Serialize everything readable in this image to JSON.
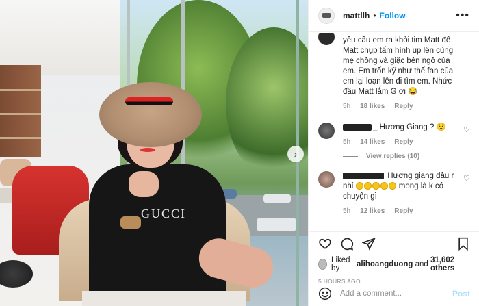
{
  "post": {
    "username": "mattllh",
    "separator": "•",
    "follow_label": "Follow",
    "more_label": "•••"
  },
  "photo": {
    "shirt_text": "GUCCI",
    "next_label": "›"
  },
  "comments": [
    {
      "text": "yêu cầu em ra khỏi tim Matt để Matt chụp tấm hình up lên cùng mẹ chồng và giặc bên ngô của em. Em trốn kỹ như thế fan của em lại loạn lên đi tìm em. Nhức đầu Matt lắm G ơi 😂",
      "time": "5h",
      "likes": "18 likes",
      "reply": "Reply"
    },
    {
      "text": "_ Hương Giang ? 😟",
      "time": "5h",
      "likes": "14 likes",
      "reply": "Reply",
      "view_replies": "View replies (10)"
    },
    {
      "text_a": "Hương giang đâu r nhỉ",
      "text_b": "mong là k có chuyện gì",
      "time": "5h",
      "likes": "12 likes",
      "reply": "Reply"
    }
  ],
  "actions": {
    "liked_prefix": "Liked by",
    "liked_user": "alihoangduong",
    "liked_and": "and",
    "liked_count": "31,602 others",
    "timestamp": "5 HOURS AGO"
  },
  "composer": {
    "placeholder": "Add a comment...",
    "post_label": "Post"
  },
  "icons": {
    "heart": "heart-icon",
    "comment": "comment-icon",
    "share": "share-icon",
    "save": "bookmark-icon",
    "emoji": "emoji-icon"
  },
  "colors": {
    "follow": "#0095f6",
    "post_disabled": "#b2dffc",
    "meta": "#8e8e8e"
  }
}
